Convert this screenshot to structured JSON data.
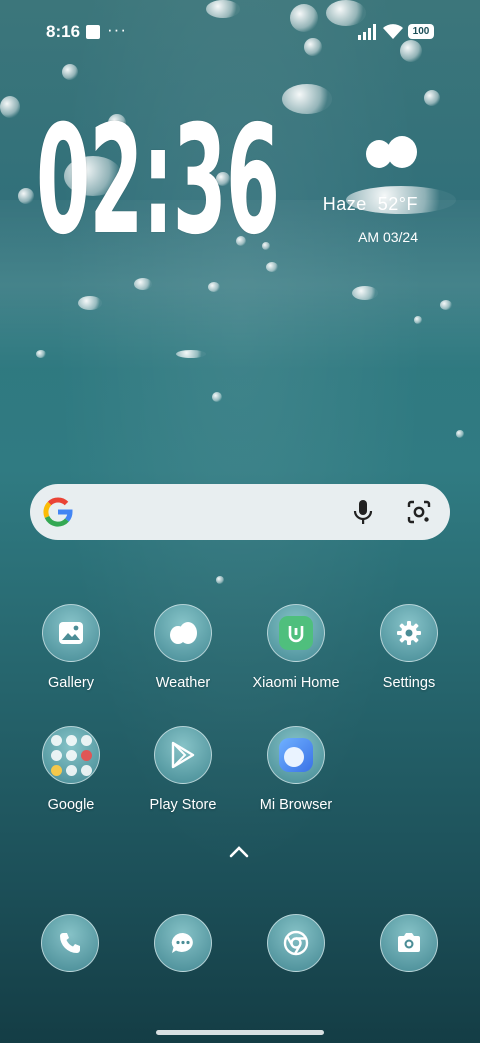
{
  "status_bar": {
    "time": "8:16",
    "extra_indicator": "···",
    "battery": "100"
  },
  "clock": {
    "time": "02:36"
  },
  "weather": {
    "condition": "Haze",
    "temperature": "52°F",
    "updated": "AM 03/24",
    "icon": "cloud-icon"
  },
  "search": {
    "logo": "google-g-logo",
    "voice_icon": "mic-icon",
    "lens_icon": "google-lens-icon"
  },
  "apps": [
    {
      "label": "Gallery",
      "icon": "gallery-icon"
    },
    {
      "label": "Weather",
      "icon": "weather-icon"
    },
    {
      "label": "Xiaomi Home",
      "icon": "xiaomi-home-icon"
    },
    {
      "label": "Settings",
      "icon": "gear-icon"
    },
    {
      "label": "Google",
      "icon": "folder-icon"
    },
    {
      "label": "Play Store",
      "icon": "play-store-icon"
    },
    {
      "label": "Mi Browser",
      "icon": "mi-browser-icon"
    }
  ],
  "dock": [
    {
      "icon": "phone-icon"
    },
    {
      "icon": "messages-icon"
    },
    {
      "icon": "chrome-icon"
    },
    {
      "icon": "camera-icon"
    }
  ],
  "colors": {
    "accent_teal": "#307b82",
    "search_bg": "#e8eef0",
    "xiaomi_green": "#4fbf7d",
    "browser_blue": "#4b8ef0"
  }
}
